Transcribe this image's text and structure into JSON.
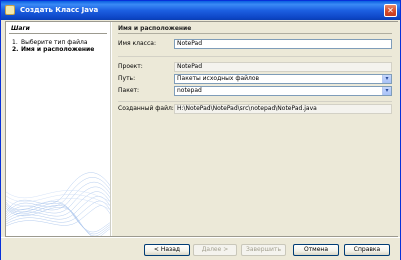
{
  "window": {
    "title": "Создать Класс Java",
    "close_glyph": "✕"
  },
  "steps": {
    "heading": "Шаги",
    "items": [
      {
        "num": "1.",
        "label": "Выберите тип файла"
      },
      {
        "num": "2.",
        "label": "Имя и расположение"
      }
    ]
  },
  "section": {
    "title": "Имя и расположение"
  },
  "form": {
    "class_name_label": "Имя класса:",
    "class_name_value": "NotePad",
    "project_label": "Проект:",
    "project_value": "NotePad",
    "location_label": "Путь:",
    "location_value": "Пакеты исходных файлов",
    "package_label": "Пакет:",
    "package_value": "notepad",
    "created_file_label": "Созданный файл:",
    "created_file_value": "H:\\NotePad\\NotePad\\src\\notepad\\NotePad.java"
  },
  "buttons": {
    "back": "< Назад",
    "next": "Далее >",
    "finish": "Завершить",
    "cancel": "Отмена",
    "help": "Справка"
  },
  "icons": {
    "dropdown": "▾"
  }
}
